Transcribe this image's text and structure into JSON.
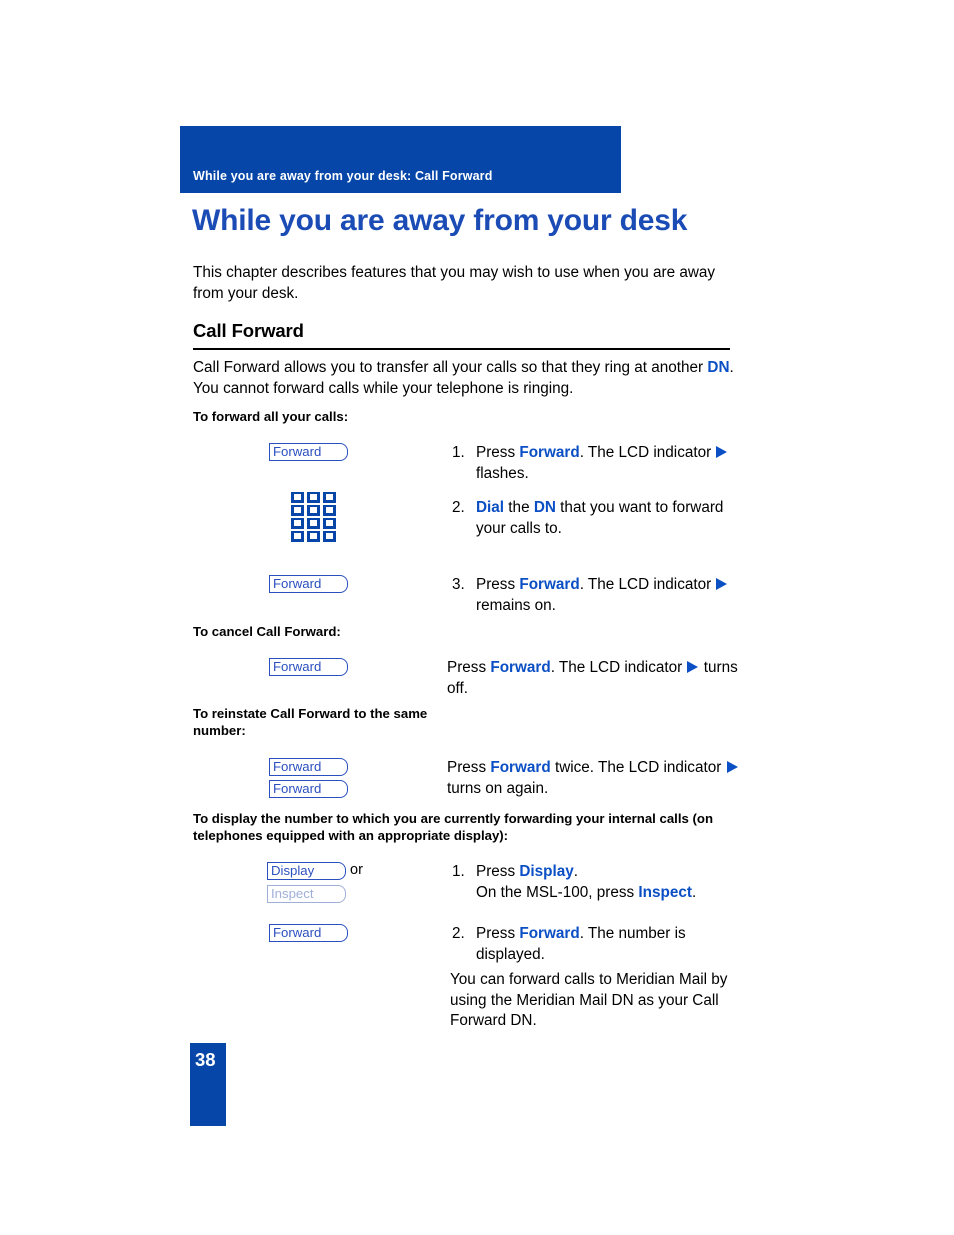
{
  "header": {
    "running_title": "While you are away from your desk: Call Forward",
    "bar_color": "#0546A8"
  },
  "chapter": {
    "title": "While you are away from your desk",
    "title_color": "#1B4BB5"
  },
  "intro": {
    "text": "This chapter describes features that you may wish to use when you are away from your desk."
  },
  "section": {
    "heading": "Call Forward",
    "intro_part1": "Call Forward allows you to transfer all your calls so that they ring at another ",
    "intro_dn": "DN",
    "intro_part2": ". You cannot forward calls while your telephone is ringing."
  },
  "subheads": {
    "forward_all": "To forward all your calls:",
    "cancel": "To cancel Call Forward:",
    "reinstate": "To reinstate Call Forward to the same number:",
    "display": "To display the number to which you are currently forwarding your internal calls (on telephones equipped with an appropriate display):"
  },
  "keys": {
    "forward": "Forward",
    "display": "Display",
    "inspect": "Inspect",
    "or": "or",
    "keypad_icon": "keypad-icon",
    "key_border_color": "#2A4FBF",
    "key_dim_color": "#9FAFD8"
  },
  "steps": {
    "s1_num": "1.",
    "s1_press": "Press ",
    "s1_key": "Forward",
    "s1_mid": ". The LCD indicator ",
    "s1_tail": " flashes.",
    "s2_num": "2.",
    "s2_dial": "Dial",
    "s2_the": " the ",
    "s2_dn": "DN",
    "s2_tail": " that you want to forward your calls to.",
    "s3_num": "3.",
    "s3_press": "Press ",
    "s3_key": "Forward",
    "s3_mid": ". The LCD indicator ",
    "s3_tail": " remains on.",
    "cancel_press": "Press ",
    "cancel_key": "Forward",
    "cancel_mid": ". The LCD indicator ",
    "cancel_tail": " turns off.",
    "reinstate_press": "Press ",
    "reinstate_key": "Forward",
    "reinstate_mid": " twice. The LCD indicator ",
    "reinstate_tail": " turns on again.",
    "d1_num": "1.",
    "d1_press": "Press  ",
    "d1_key": "Display",
    "d1_period": ".",
    "d1_line2_pre": "On the MSL-100, press ",
    "d1_line2_key": "Inspect",
    "d1_line2_post": ".",
    "d2_num": "2.",
    "d2_press": "Press  ",
    "d2_key": "Forward",
    "d2_tail": ". The number is displayed.",
    "note": "You can forward calls to Meridian Mail by using the Meridian Mail DN as your Call Forward DN."
  },
  "footer": {
    "page_number": "38",
    "block_color": "#0546A8"
  }
}
